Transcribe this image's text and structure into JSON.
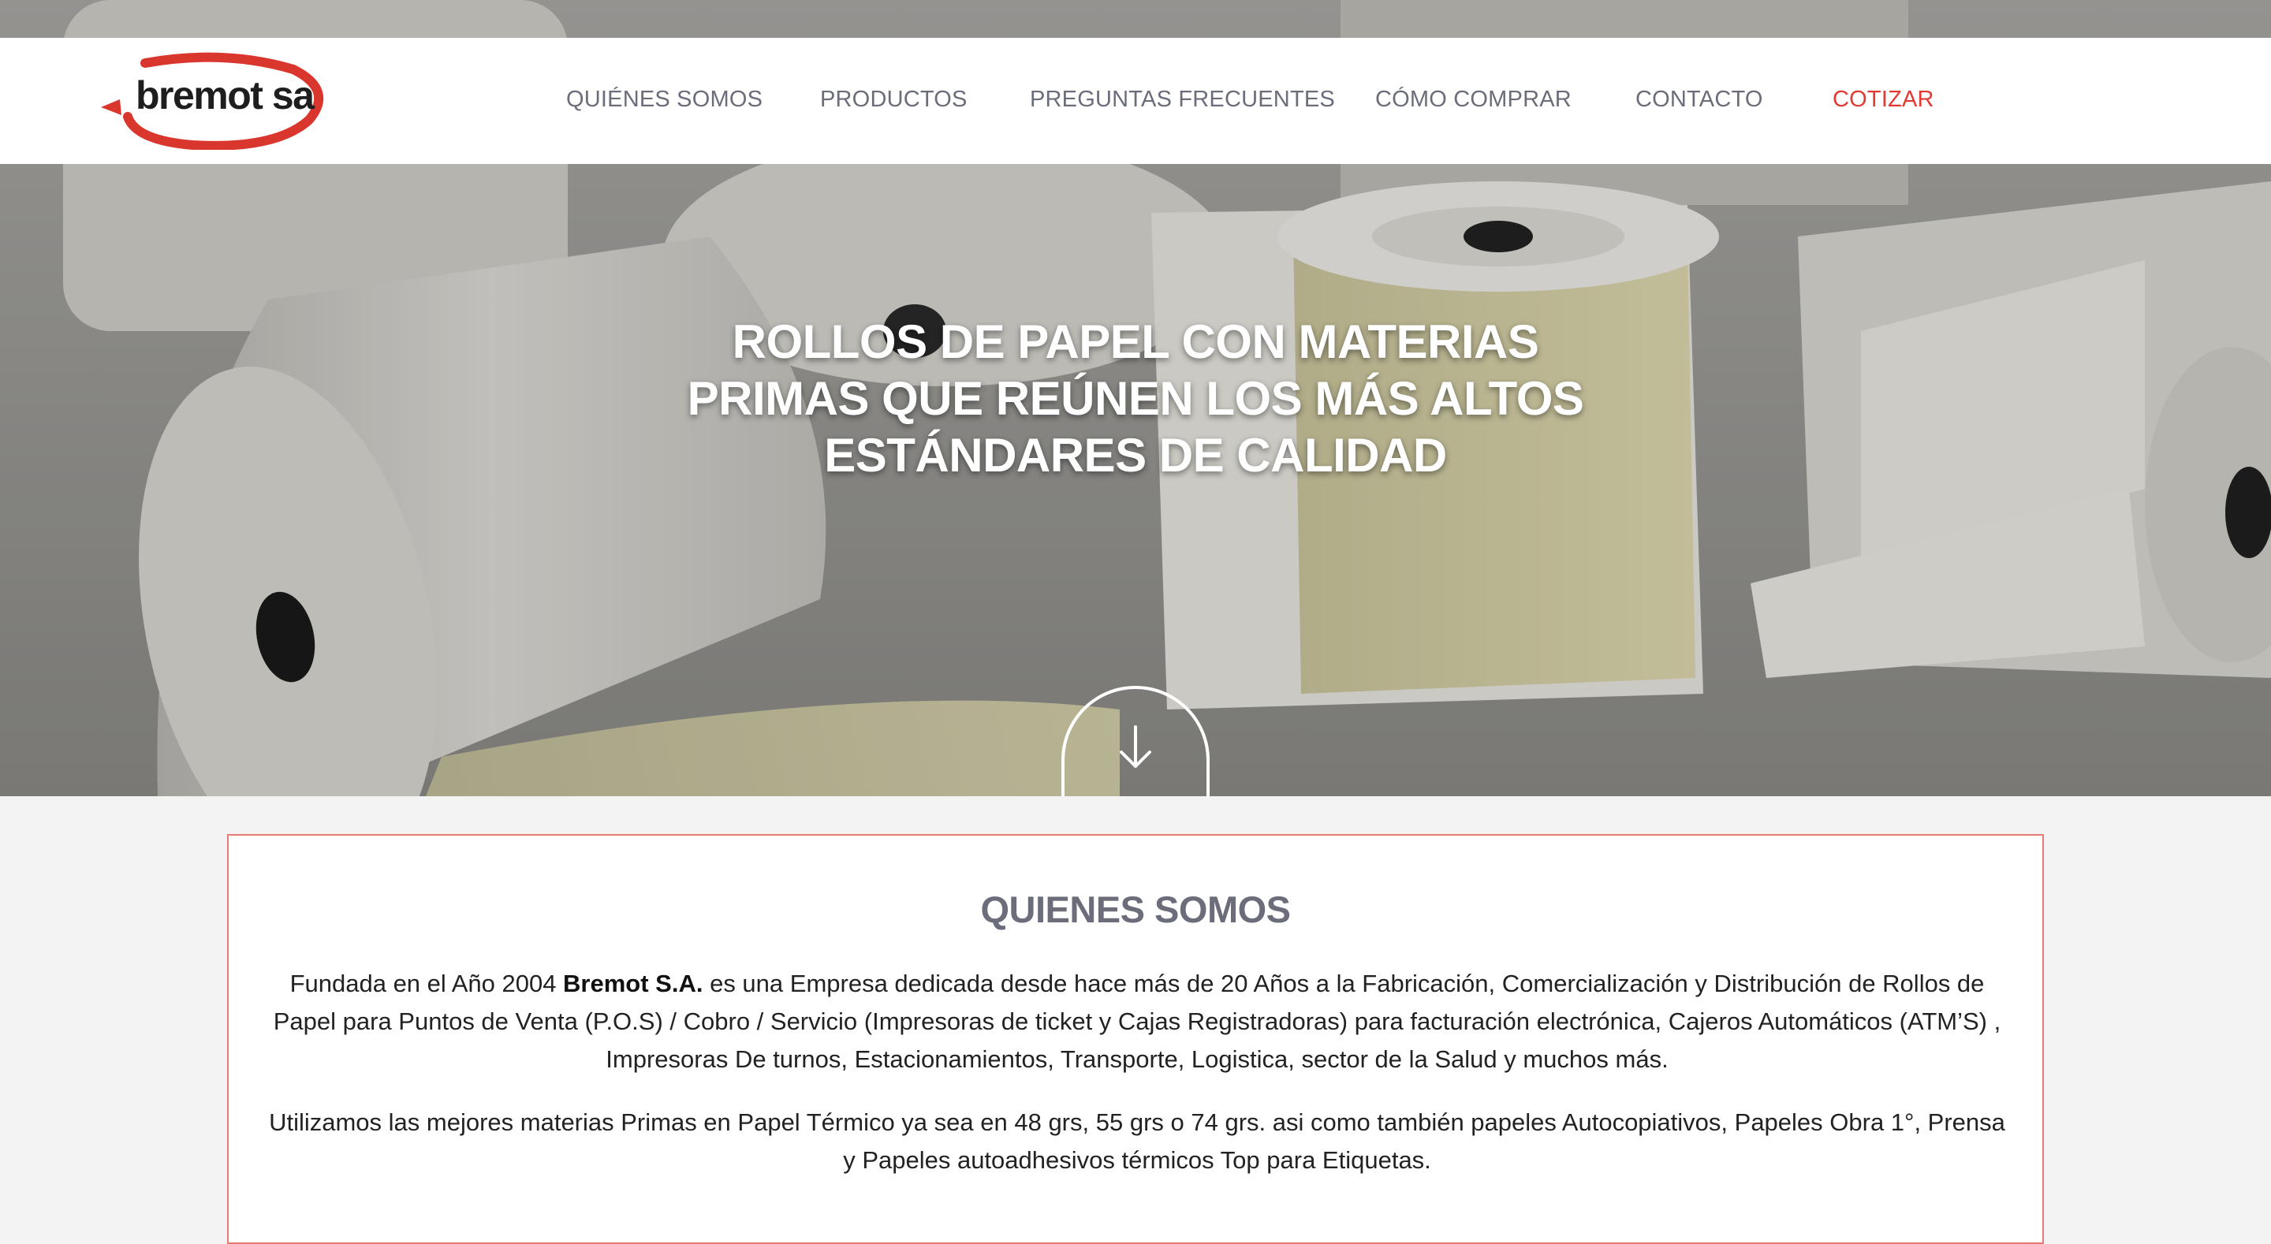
{
  "brand": {
    "name": "bremot sa",
    "logo_color": "#d9362e"
  },
  "nav": {
    "items": [
      {
        "label": "QUIÉNES SOMOS"
      },
      {
        "label": "PRODUCTOS"
      },
      {
        "label": "PREGUNTAS FRECUENTES"
      },
      {
        "label": "CÓMO COMPRAR"
      },
      {
        "label": "CONTACTO"
      },
      {
        "label": "COTIZAR"
      }
    ],
    "accent_color": "#e23a32"
  },
  "hero": {
    "title_line1": "ROLLOS DE PAPEL CON MATERIAS",
    "title_line2": "PRIMAS QUE REÚNEN LOS MÁS ALTOS",
    "title_line3": "ESTÁNDARES DE CALIDAD",
    "scroll_icon": "arrow-down-icon"
  },
  "about": {
    "heading": "QUIENES SOMOS",
    "p1_before": "Fundada en el Año 2004 ",
    "p1_bold": "Bremot S.A.",
    "p1_after": " es una Empresa dedicada desde hace más de 20 Años a la Fabricación, Comercialización y Distribución de Rollos de Papel para Puntos de Venta (P.O.S) / Cobro / Servicio (Impresoras de ticket y Cajas Registradoras) para facturación electrónica, Cajeros Automáticos (ATM’S) , Impresoras De turnos, Estacionamientos, Transporte, Logistica, sector de la Salud y muchos más.",
    "p2": "Utilizamos las mejores materias Primas en Papel Térmico ya sea en 48 grs, 55 grs o 74 grs. asi como también papeles Autocopiativos, Papeles Obra 1°, Prensa y Papeles autoadhesivos térmicos Top para Etiquetas.",
    "border_color": "#e67a72"
  }
}
